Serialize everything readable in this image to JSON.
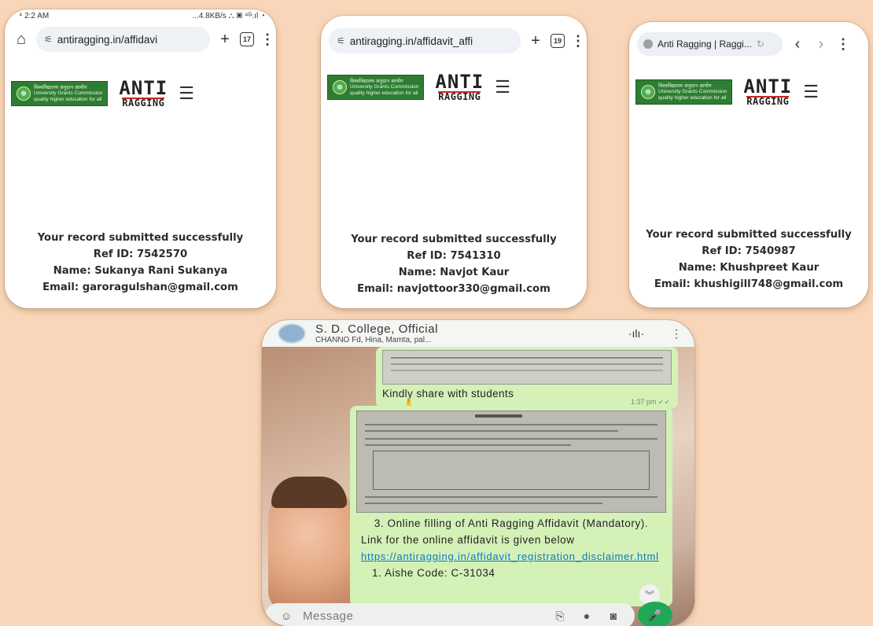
{
  "card1": {
    "status_time": "⁴ 2:2 AM",
    "status_right": "...4.8KB/s ⛬ ▣ ⁴ᴳ.ıl ◔",
    "url": "antiragging.in/affidavi",
    "tab_count": "17",
    "record": {
      "message": "Your record submitted successfully",
      "ref": "Ref ID: 7542570",
      "name": "Name: Sukanya Rani Sukanya",
      "email": "Email: garoragulshan@gmail.com"
    }
  },
  "card2": {
    "url": "antiragging.in/affidavit_affi",
    "tab_count": "19",
    "record": {
      "message": "Your record submitted successfully",
      "ref": "Ref ID: 7541310",
      "name": "Name: Navjot Kaur",
      "email": "Email: navjottoor330@gmail.com"
    }
  },
  "card3": {
    "tab_title": "Anti Ragging | Raggi...",
    "record": {
      "message": "Your record submitted successfully",
      "ref": "Ref ID: 7540987",
      "name": "Name: Khushpreet Kaur",
      "email": "Email: khushigill748@gmail.com"
    }
  },
  "logos": {
    "ugc_line1": "विश्वविद्यालय अनुदान आयोग",
    "ugc_line2": "University Grants Commission",
    "ugc_line3": "quality higher education for all",
    "anti": "ANTI",
    "ragging": "RAGGING"
  },
  "whatsapp": {
    "chat_name": "S. D. College, Official",
    "members": "CHANNO Fd, Hina, Mamta, pal...",
    "msg1_text": "Kindly share with students",
    "msg1_emoji": "🙏",
    "msg1_time": "1:37 pm ✓✓",
    "msg2_heading": "3. Online filling of Anti Ragging Affidavit (Mandatory).",
    "msg2_body": "Link for the online affidavit is given below",
    "msg2_link": "https://antiragging.in/affidavit_registration_disclaimer.html",
    "msg2_extra": "1. Aishe Code: C-31034",
    "input_placeholder": "Message"
  },
  "colors": {
    "background": "#f9d6b9",
    "ugc_green": "#2e7d32",
    "wa_bubble": "#d4f1b8",
    "wa_link": "#0b7ac2",
    "wa_mic": "#1fa855"
  }
}
